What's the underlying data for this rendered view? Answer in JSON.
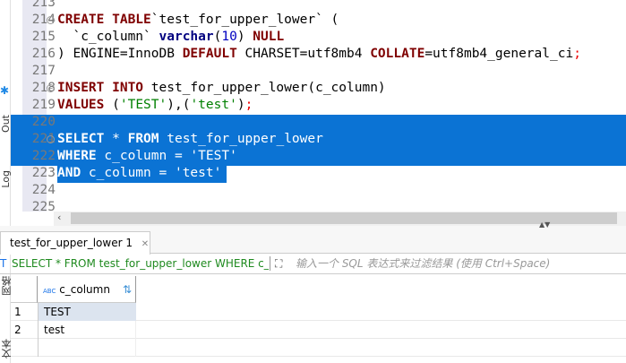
{
  "left_panel": {
    "labels": [
      "Out",
      "Log",
      "网格",
      "文本"
    ]
  },
  "editor": {
    "lines": [
      {
        "n": "213",
        "html": ""
      },
      {
        "n": "214",
        "fold": true,
        "parts": [
          [
            "kw",
            "CREATE TABLE"
          ],
          [
            "",
            "`test_for_upper_lower` ("
          ]
        ]
      },
      {
        "n": "215",
        "parts": [
          [
            "",
            "  `c_column` "
          ],
          [
            "kb",
            "varchar"
          ],
          [
            "",
            "("
          ],
          [
            "num",
            "10"
          ],
          [
            "",
            ") "
          ],
          [
            "kw",
            "NULL"
          ]
        ]
      },
      {
        "n": "216",
        "parts": [
          [
            "",
            ") ENGINE=InnoDB "
          ],
          [
            "kw",
            "DEFAULT"
          ],
          [
            "",
            " CHARSET=utf8mb4 "
          ],
          [
            "kw",
            "COLLATE"
          ],
          [
            "",
            "=utf8mb4_general_ci"
          ],
          [
            "semi",
            ";"
          ]
        ]
      },
      {
        "n": "217",
        "parts": []
      },
      {
        "n": "218",
        "fold": true,
        "parts": [
          [
            "kw",
            "INSERT INTO"
          ],
          [
            "",
            " test_for_upper_lower(c_column)"
          ]
        ]
      },
      {
        "n": "219",
        "parts": [
          [
            "kw",
            "VALUES"
          ],
          [
            "",
            " ("
          ],
          [
            "str",
            "'TEST'"
          ],
          [
            "",
            "),("
          ],
          [
            "str",
            "'test'"
          ],
          [
            "",
            ")"
          ],
          [
            "semi",
            ";"
          ]
        ]
      },
      {
        "n": "220",
        "parts": []
      },
      {
        "n": "221",
        "fold": true,
        "parts": [
          [
            "kw",
            "SELECT"
          ],
          [
            "",
            " * "
          ],
          [
            "kw",
            "FROM"
          ],
          [
            "",
            " test_for_upper_lower"
          ]
        ]
      },
      {
        "n": "222",
        "parts": [
          [
            "kw",
            "WHERE"
          ],
          [
            "",
            " c_column = "
          ],
          [
            "str",
            "'TEST'"
          ]
        ]
      },
      {
        "n": "223",
        "parts": [
          [
            "kw",
            "AND"
          ],
          [
            "",
            " c_column = "
          ],
          [
            "str",
            "'test'"
          ]
        ]
      },
      {
        "n": "224",
        "parts": []
      },
      {
        "n": "225",
        "parts": []
      }
    ]
  },
  "results_tab": {
    "label": "test_for_upper_lower 1",
    "close": "✕"
  },
  "filter": {
    "query": "SELECT * FROM test_for_upper_lower WHERE c_co",
    "placeholder": "输入一个 SQL 表达式来过滤结果 (使用 Ctrl+Space)"
  },
  "grid": {
    "column": "c_column",
    "type_badge": "ABC",
    "rows": [
      {
        "n": "1",
        "v": "TEST"
      },
      {
        "n": "2",
        "v": "test"
      }
    ]
  }
}
